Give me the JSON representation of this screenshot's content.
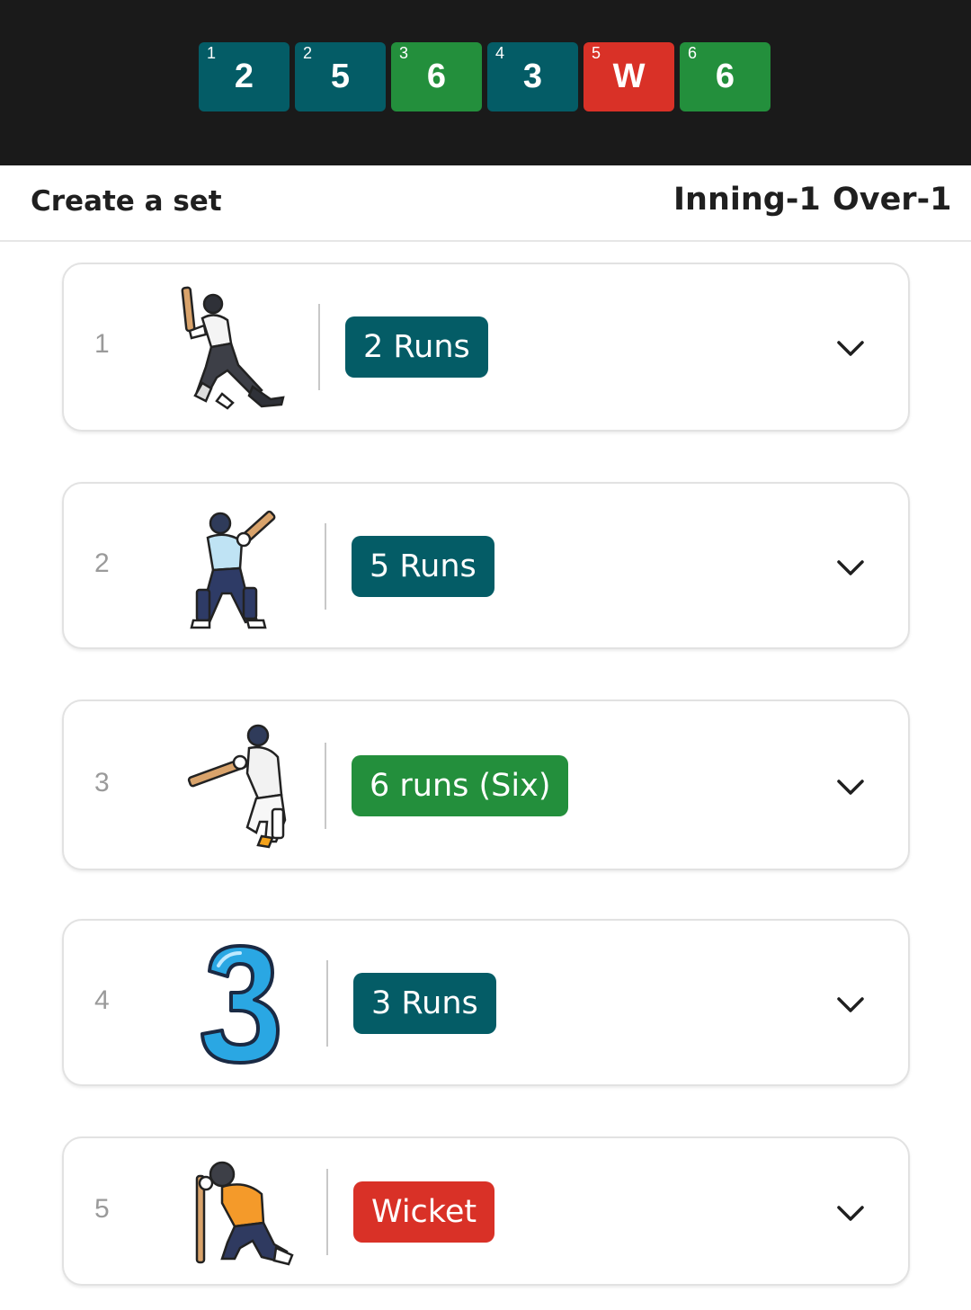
{
  "over_balls": [
    {
      "index": "1",
      "value": "2",
      "type": "runs",
      "color": "#045c66"
    },
    {
      "index": "2",
      "value": "5",
      "type": "runs",
      "color": "#045c66"
    },
    {
      "index": "3",
      "value": "6",
      "type": "six",
      "color": "#238f3c"
    },
    {
      "index": "4",
      "value": "3",
      "type": "runs",
      "color": "#045c66"
    },
    {
      "index": "5",
      "value": "W",
      "type": "wicket",
      "color": "#d93127"
    },
    {
      "index": "6",
      "value": "6",
      "type": "six",
      "color": "#238f3c"
    }
  ],
  "header": {
    "title": "Create a set",
    "inning": "Inning-1",
    "over": "Over-1"
  },
  "deliveries": [
    {
      "number": "1",
      "label": "2 Runs",
      "color": "#045c66",
      "icon": "batsman-drive-icon"
    },
    {
      "number": "2",
      "label": "5 Runs",
      "color": "#045c66",
      "icon": "batsman-pull-icon"
    },
    {
      "number": "3",
      "label": "6 runs (Six)",
      "color": "#238f3c",
      "icon": "batsman-six-icon"
    },
    {
      "number": "4",
      "label": "3 Runs",
      "color": "#045c66",
      "icon": "number-three-icon"
    },
    {
      "number": "5",
      "label": "Wicket",
      "color": "#d93127",
      "icon": "batsman-out-icon"
    }
  ]
}
